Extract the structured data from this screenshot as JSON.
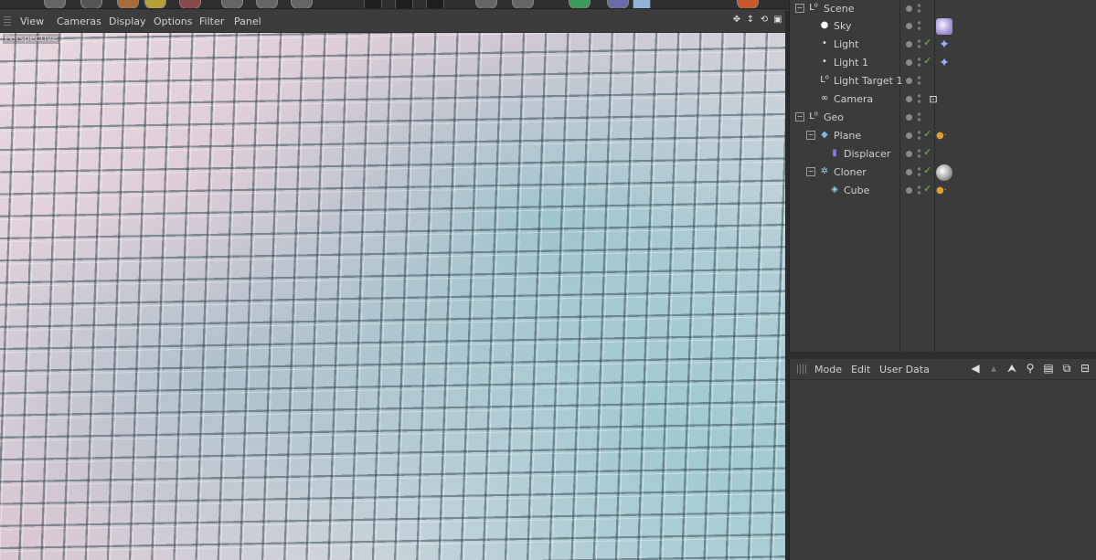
{
  "viewport": {
    "menu": [
      "View",
      "Cameras",
      "Display",
      "Options",
      "Filter",
      "Panel"
    ],
    "label": "Perspective"
  },
  "objects": [
    {
      "name": "Scene",
      "icon": "layer-icon",
      "level": 0
    },
    {
      "name": "Sky",
      "icon": "sky-icon",
      "level": 1,
      "tag": "material-tag"
    },
    {
      "name": "Light",
      "icon": "light-icon",
      "level": 1,
      "check": "✓",
      "tag": "target-tag"
    },
    {
      "name": "Light 1",
      "icon": "light-icon",
      "level": 1,
      "check": "✓",
      "tag": "target-tag"
    },
    {
      "name": "Light Target 1",
      "icon": "null-icon",
      "level": 1
    },
    {
      "name": "Camera",
      "icon": "camera-icon",
      "level": 1,
      "tag": "camera-tag"
    },
    {
      "name": "Geo",
      "icon": "layer-icon",
      "level": 0
    },
    {
      "name": "Plane",
      "icon": "plane-icon",
      "level": 1,
      "check": "✓",
      "tag": "phong-tag"
    },
    {
      "name": "Displacer",
      "icon": "displacer-icon",
      "level": 2,
      "check": "✓"
    },
    {
      "name": "Cloner",
      "icon": "cloner-icon",
      "level": 1,
      "check": "✓",
      "tag": "material-tag"
    },
    {
      "name": "Cube",
      "icon": "cube-icon",
      "level": 2,
      "check": "✓",
      "tag": "phong-tag"
    }
  ],
  "attributes": {
    "menu": [
      "Mode",
      "Edit",
      "User Data"
    ]
  },
  "colors": {
    "panel": "#3b3b3b",
    "check": "#7cc04a"
  }
}
